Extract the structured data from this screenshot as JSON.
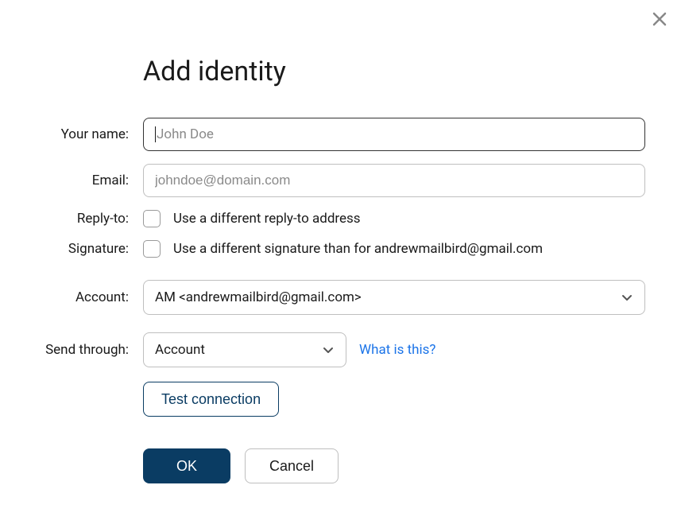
{
  "dialog": {
    "title": "Add identity"
  },
  "fields": {
    "name": {
      "label": "Your name:",
      "placeholder": "John Doe",
      "value": ""
    },
    "email": {
      "label": "Email:",
      "placeholder": "johndoe@domain.com",
      "value": ""
    },
    "reply_to": {
      "label": "Reply-to:",
      "checkbox_text": "Use a different reply-to address"
    },
    "signature": {
      "label": "Signature:",
      "checkbox_text": "Use a different signature than for andrewmailbird@gmail.com"
    },
    "account": {
      "label": "Account:",
      "selected": "AM <andrewmailbird@gmail.com>"
    },
    "send_through": {
      "label": "Send through:",
      "selected": "Account",
      "help_text": "What is this?"
    }
  },
  "buttons": {
    "test_connection": "Test connection",
    "ok": "OK",
    "cancel": "Cancel"
  }
}
